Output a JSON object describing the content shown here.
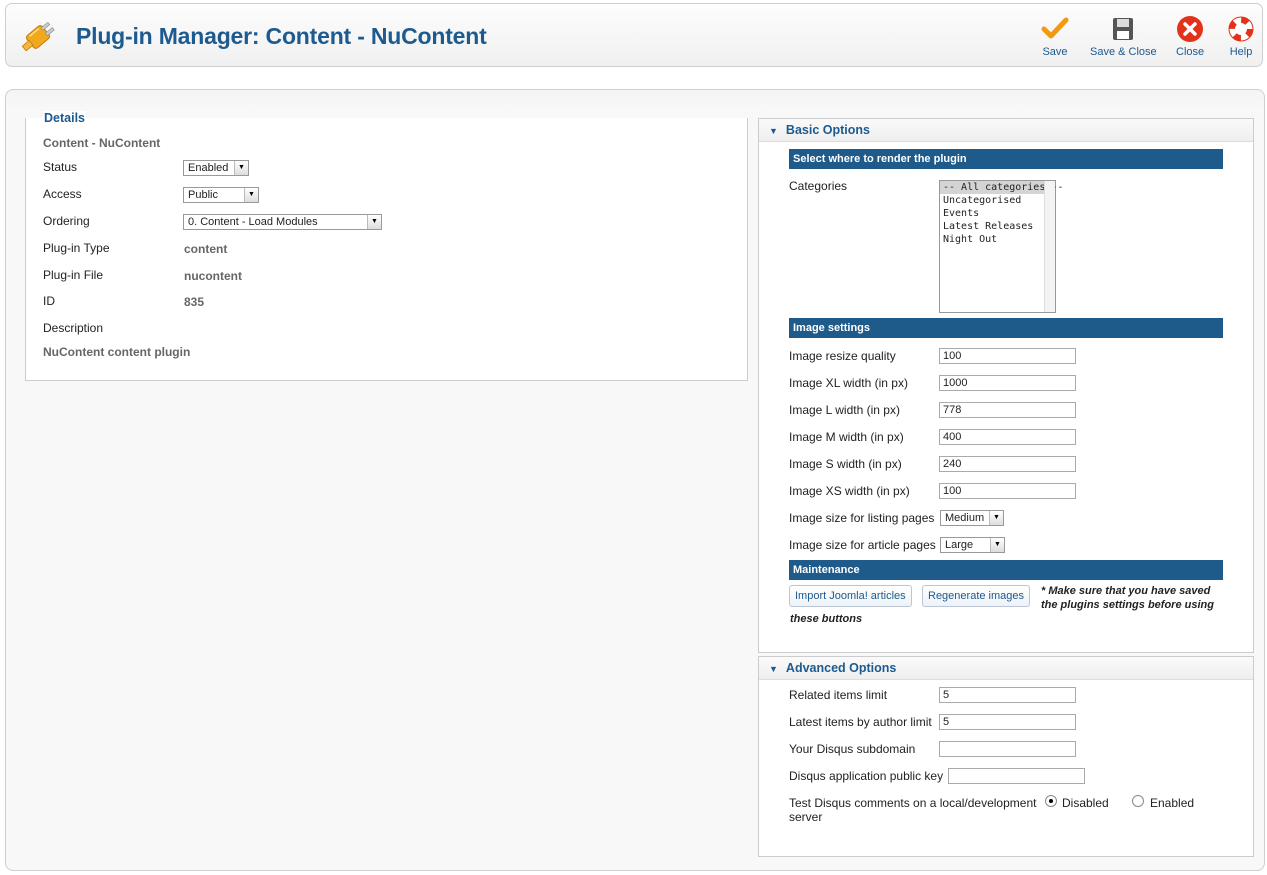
{
  "header": {
    "title": "Plug-in Manager: Content - NuContent",
    "buttons": {
      "save": "Save",
      "save_close": "Save & Close",
      "close": "Close",
      "help": "Help"
    }
  },
  "details": {
    "legend": "Details",
    "plugin_name": "Content - NuContent",
    "status_label": "Status",
    "status_value": "Enabled",
    "access_label": "Access",
    "access_value": "Public",
    "ordering_label": "Ordering",
    "ordering_value": "0. Content - Load Modules",
    "type_label": "Plug-in Type",
    "type_value": "content",
    "file_label": "Plug-in File",
    "file_value": "nucontent",
    "id_label": "ID",
    "id_value": "835",
    "description_label": "Description",
    "description_value": "NuContent content plugin"
  },
  "basic": {
    "title": "Basic Options",
    "render_bar": "Select where to render the plugin",
    "categories_label": "Categories",
    "categories": [
      "-- All categories --",
      "Uncategorised",
      "Events",
      "Latest Releases",
      "Night Out"
    ],
    "image_bar": "Image settings",
    "quality_label": "Image resize quality",
    "quality_value": "100",
    "xl_label": "Image XL width (in px)",
    "xl_value": "1000",
    "l_label": "Image L width (in px)",
    "l_value": "778",
    "m_label": "Image M width (in px)",
    "m_value": "400",
    "s_label": "Image S width (in px)",
    "s_value": "240",
    "xs_label": "Image XS width (in px)",
    "xs_value": "100",
    "listing_label": "Image size for listing pages",
    "listing_value": "Medium",
    "article_label": "Image size for article pages",
    "article_value": "Large",
    "maint_bar": "Maintenance",
    "import_btn": "Import Joomla! articles",
    "regen_btn": "Regenerate images",
    "note_line1": "* Make sure that you have saved",
    "note_line2": "the plugins settings before using",
    "note_line3": "these buttons"
  },
  "advanced": {
    "title": "Advanced Options",
    "related_label": "Related items limit",
    "related_value": "5",
    "author_label": "Latest items by author limit",
    "author_value": "5",
    "disqus_sub_label": "Your Disqus subdomain",
    "disqus_sub_value": "",
    "disqus_key_label": "Disqus application public key",
    "disqus_key_value": "",
    "test_label_line1": "Test Disqus comments on a local/development",
    "test_label_line2": "server",
    "disabled_label": "Disabled",
    "enabled_label": "Enabled"
  }
}
